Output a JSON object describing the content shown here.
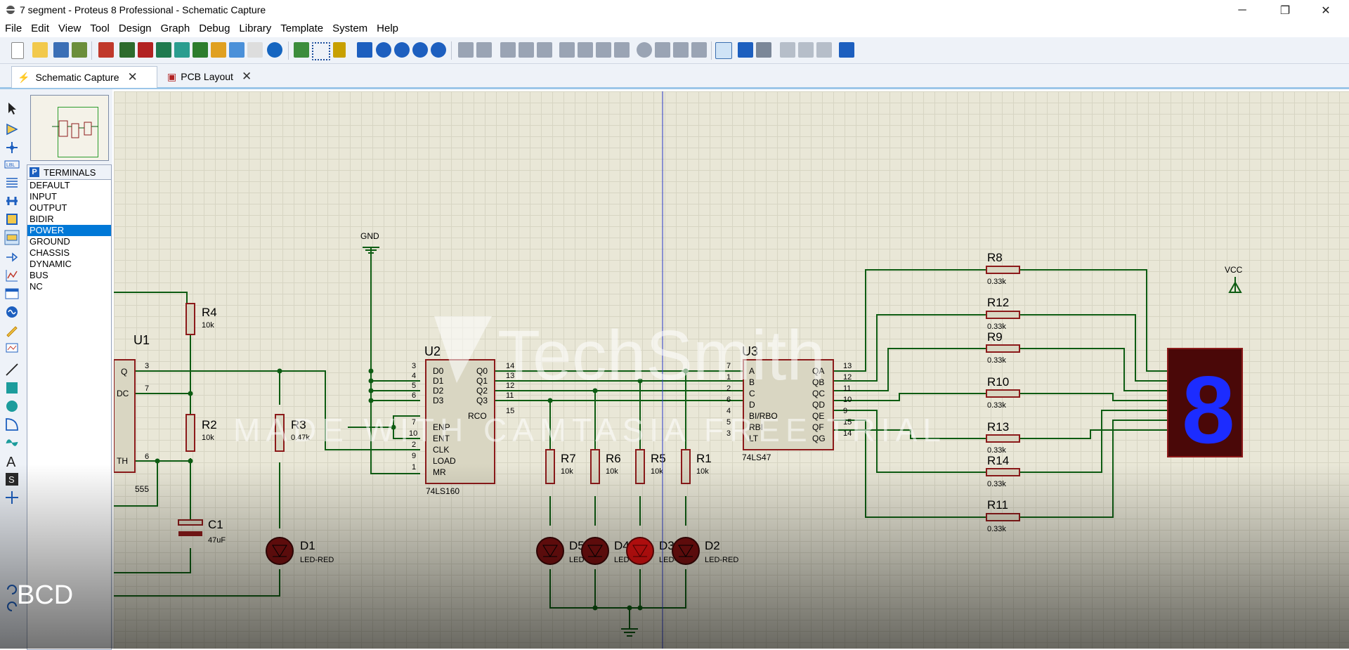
{
  "window": {
    "title": "7 segment - Proteus 8 Professional - Schematic Capture",
    "controls": {
      "minimize": "─",
      "maximize": "❐",
      "close": "✕"
    }
  },
  "menu": [
    "File",
    "Edit",
    "View",
    "Tool",
    "Design",
    "Graph",
    "Debug",
    "Library",
    "Template",
    "System",
    "Help"
  ],
  "tabs": [
    {
      "label": "Schematic Capture",
      "close": "✕"
    },
    {
      "label": "PCB Layout",
      "close": "✕"
    }
  ],
  "picker": {
    "mode_button": "P",
    "title": "TERMINALS",
    "items": [
      "DEFAULT",
      "INPUT",
      "OUTPUT",
      "BIDIR",
      "POWER",
      "GROUND",
      "CHASSIS",
      "DYNAMIC",
      "BUS",
      "NC"
    ],
    "selected": "POWER"
  },
  "schematic": {
    "gnd": "GND",
    "vcc": "VCC",
    "u1": {
      "ref": "U1",
      "part": "555",
      "pins": [
        "Q",
        "DC",
        "TH"
      ],
      "pin_numbers": [
        "3",
        "7",
        "6"
      ]
    },
    "u2": {
      "ref": "U2",
      "part": "74LS160",
      "left_pins": [
        "D0",
        "D1",
        "D2",
        "D3",
        "ENP",
        "ENT",
        "CLK",
        "LOAD",
        "MR"
      ],
      "left_nums": [
        "3",
        "4",
        "5",
        "6",
        "7",
        "10",
        "2",
        "9",
        "1"
      ],
      "right_pins": [
        "Q0",
        "Q1",
        "Q2",
        "Q3",
        "RCO"
      ],
      "right_nums": [
        "14",
        "13",
        "12",
        "11",
        "15"
      ]
    },
    "u3": {
      "ref": "U3",
      "part": "74LS47",
      "left_pins": [
        "A",
        "B",
        "C",
        "D",
        "BI/RBO",
        "RBI",
        "LT"
      ],
      "left_nums": [
        "7",
        "1",
        "2",
        "6",
        "4",
        "5",
        "3"
      ],
      "right_pins": [
        "QA",
        "QB",
        "QC",
        "QD",
        "QE",
        "QF",
        "QG"
      ],
      "right_nums": [
        "13",
        "12",
        "11",
        "10",
        "9",
        "15",
        "14"
      ]
    },
    "resistors_left": [
      {
        "ref": "R4",
        "val": "10k"
      },
      {
        "ref": "R2",
        "val": "10k"
      },
      {
        "ref": "R3",
        "val": "0.47k"
      },
      {
        "ref": "R7",
        "val": "10k"
      },
      {
        "ref": "R6",
        "val": "10k"
      },
      {
        "ref": "R5",
        "val": "10k"
      },
      {
        "ref": "R1",
        "val": "10k"
      }
    ],
    "resistors_right": [
      {
        "ref": "R8",
        "val": "0.33k"
      },
      {
        "ref": "R12",
        "val": "0.33k"
      },
      {
        "ref": "R9",
        "val": "0.33k"
      },
      {
        "ref": "R10",
        "val": "0.33k"
      },
      {
        "ref": "R13",
        "val": "0.33k"
      },
      {
        "ref": "R14",
        "val": "0.33k"
      },
      {
        "ref": "R11",
        "val": "0.33k"
      }
    ],
    "capacitor": {
      "ref": "C1",
      "val": "47uF"
    },
    "leds": [
      {
        "ref": "D1",
        "val": "LED-RED"
      },
      {
        "ref": "D5",
        "val": "LED-RED"
      },
      {
        "ref": "D4",
        "val": "LED-RED"
      },
      {
        "ref": "D3",
        "val": "LED-RED"
      },
      {
        "ref": "D2",
        "val": "LED-RED"
      }
    ],
    "display_digit": "8"
  },
  "watermark": {
    "logo": "TechSmith",
    "banner": "MADE WITH CAMTASIA FREE TRIAL"
  },
  "overlay_caption": "BCD",
  "colors": {
    "wire": "#0d5c12",
    "component": "#8c1a1a",
    "canvas": "#e9e7d7",
    "display_seg": "#1c2cff",
    "selection": "#0078d7"
  }
}
